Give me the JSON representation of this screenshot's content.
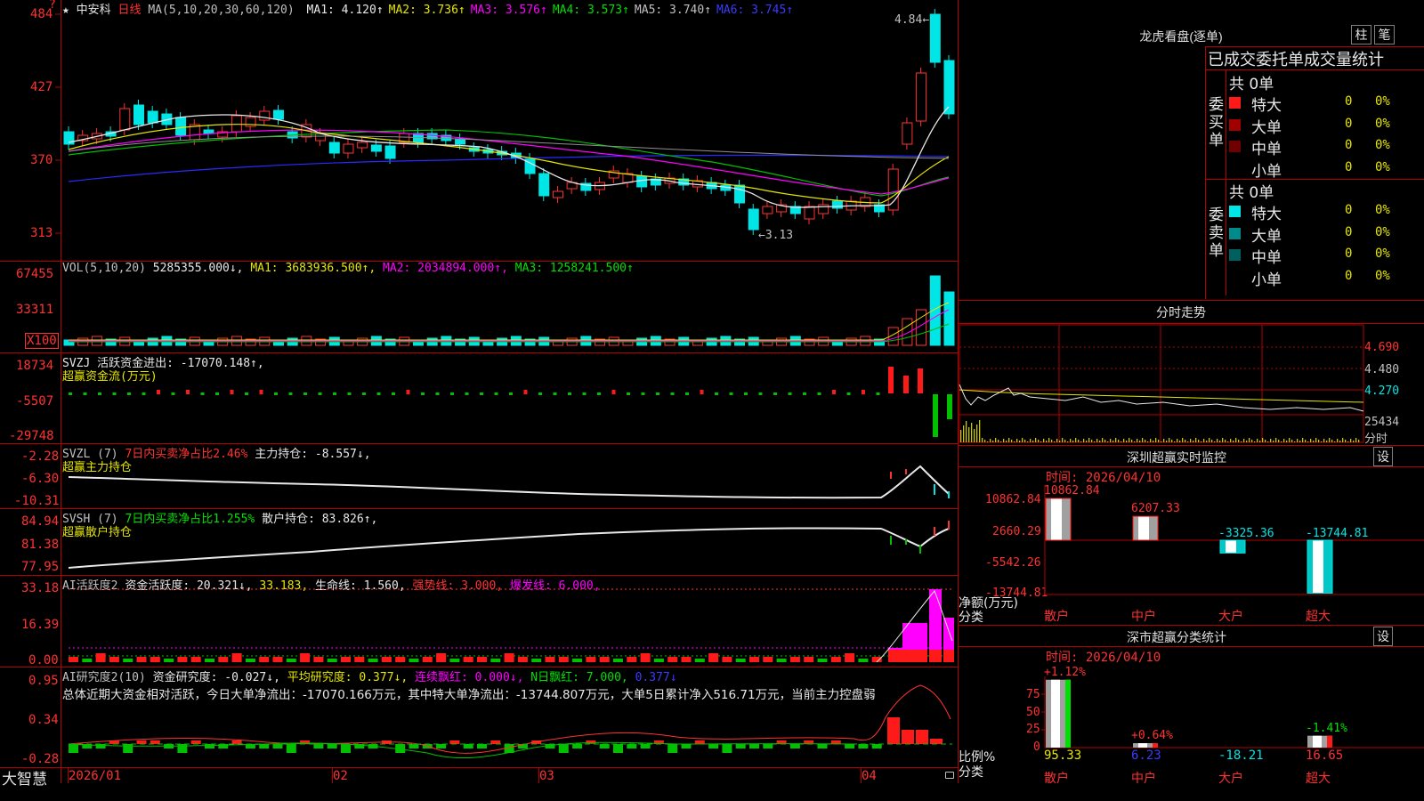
{
  "main": {
    "star": "★",
    "stock_name": "中安科",
    "period": "日线",
    "ma_params": "MA(5,10,20,30,60,120)",
    "ma_items": [
      {
        "label": "MA1:",
        "value": "4.120↑",
        "color": "#e8e8e8"
      },
      {
        "label": "MA2:",
        "value": "3.736↑",
        "color": "#e6e600"
      },
      {
        "label": "MA3:",
        "value": "3.576↑",
        "color": "#ff00ff"
      },
      {
        "label": "MA4:",
        "value": "3.573↑",
        "color": "#00e000"
      },
      {
        "label": "MA5:",
        "value": "3.740↑",
        "color": "#c0c0c0"
      },
      {
        "label": "MA6:",
        "value": "3.745↑",
        "color": "#3a3aff"
      }
    ],
    "price_axis": [
      "484",
      "427",
      "370",
      "313"
    ],
    "high_label": "4.84",
    "low_label": "3.13"
  },
  "vol": {
    "header": "VOL(5,10,20)",
    "value": "5285355.000↓,",
    "ma1": "MA1: 3683936.500↑,",
    "ma2": "MA2: 2034894.000↑,",
    "ma3": "MA3: 1258241.500↑",
    "axis": [
      "67455",
      "33311",
      "X100"
    ]
  },
  "svzj": {
    "header": "SVZJ  活跃资金进出: -17070.148↑,",
    "sub": "超赢资金流(万元)",
    "axis": [
      "18734",
      "-5507",
      "-29748"
    ]
  },
  "svzl": {
    "header1": "SVZL (7)",
    "header2": "7日内买卖净占比2.46%",
    "header3": "主力持仓: -8.557↓,",
    "sub": "超赢主力持仓",
    "axis": [
      "-2.28",
      "-6.30",
      "-10.31"
    ]
  },
  "svsh": {
    "header1": "SVSH (7)",
    "header2": "7日内买卖净占比1.255%",
    "header3": "散户持仓: 83.826↑,",
    "sub": "超赢散户持仓",
    "axis": [
      "84.94",
      "81.38",
      "77.95"
    ]
  },
  "ai2": {
    "header1": "AI活跃度2",
    "header2": "资金活跃度: 20.321↓,",
    "header3": "33.183,",
    "header4": "生命线: 1.560,",
    "header5": "强势线: 3.000,",
    "header6": "爆发线: 6.000,",
    "axis": [
      "33.18",
      "16.39",
      "0.00"
    ]
  },
  "ai_research": {
    "header1": "AI研究度2(10)",
    "header2": "资金研究度: -0.027↓,",
    "header3": "平均研究度: 0.377↓,",
    "header4": "连续飘红: 0.000↓,",
    "header5": "N日飘红: 7.000,",
    "header6": "0.377↓",
    "summary": "总体近期大资金相对活跃，今日大单净流出：-17070.166万元，其中特大单净流出：-13744.807万元，大单5日累计净入516.71万元，当前主力控盘弱",
    "axis": [
      "0.95",
      "0.34",
      "-0.28"
    ]
  },
  "x_axis": {
    "brand": "大智慧",
    "labels": [
      "2026/01",
      "02",
      "03",
      "04"
    ]
  },
  "right": {
    "lhb_title": "龙虎看盘(逐单)",
    "btn_zhu": "柱",
    "btn_bi": "笔",
    "stats_title": "已成交委托单成交量统计",
    "buy": {
      "side_label": "委买单",
      "total": "共 0单",
      "rows": [
        {
          "name": "特大",
          "count": "0",
          "pct": "0%",
          "color": "#ff1a1a"
        },
        {
          "name": "大单",
          "count": "0",
          "pct": "0%",
          "color": "#a00000"
        },
        {
          "name": "中单",
          "count": "0",
          "pct": "0%",
          "color": "#700000"
        },
        {
          "name": "小单",
          "count": "0",
          "pct": "0%",
          "color": "#000000"
        }
      ]
    },
    "sell": {
      "side_label": "委卖单",
      "total": "共 0单",
      "rows": [
        {
          "name": "特大",
          "count": "0",
          "pct": "0%",
          "color": "#00e6e6"
        },
        {
          "name": "大单",
          "count": "0",
          "pct": "0%",
          "color": "#008a8a"
        },
        {
          "name": "中单",
          "count": "0",
          "pct": "0%",
          "color": "#006060"
        },
        {
          "name": "小单",
          "count": "0",
          "pct": "0%",
          "color": "#000000"
        }
      ]
    },
    "fenshi": {
      "title": "分时走势",
      "axis": [
        "4.690",
        "4.480",
        "4.270",
        "25434",
        "分时"
      ]
    },
    "sz_monitor": {
      "title": "深圳超赢实时监控",
      "btn": "设",
      "time": "时间: 2026/04/10",
      "axis": [
        "10862.84",
        "2660.29",
        "-5542.26",
        "-13744.81"
      ],
      "unit1": "净额(万元)",
      "unit2": "分类",
      "bars": [
        {
          "cat": "散户",
          "value": 10862.84,
          "label": "10862.84"
        },
        {
          "cat": "中户",
          "value": 6207.33,
          "label": "6207.33"
        },
        {
          "cat": "大户",
          "value": -3325.36,
          "label": "-3325.36"
        },
        {
          "cat": "超大",
          "value": -13744.81,
          "label": "-13744.81"
        }
      ]
    },
    "sz_class": {
      "title": "深市超赢分类统计",
      "btn": "设",
      "time": "时间: 2026/04/10",
      "axis": [
        "75",
        "50",
        "25",
        "0"
      ],
      "unit1": "比例%",
      "unit2": "分类",
      "bars": [
        {
          "cat": "散户",
          "value": 95.33,
          "change": "+1.12%",
          "label": "95.33"
        },
        {
          "cat": "中户",
          "value": 6.23,
          "change": "+0.64%",
          "label": "6.23"
        },
        {
          "cat": "大户",
          "value": -18.21,
          "change": "",
          "label": "-18.21"
        },
        {
          "cat": "超大",
          "value": 16.65,
          "change": "-1.41%",
          "label": "16.65"
        }
      ]
    }
  },
  "colors": {
    "up": "#ff3232",
    "down": "#00e6e6",
    "grid": "#b40000",
    "axis_text": "#ff3232"
  }
}
